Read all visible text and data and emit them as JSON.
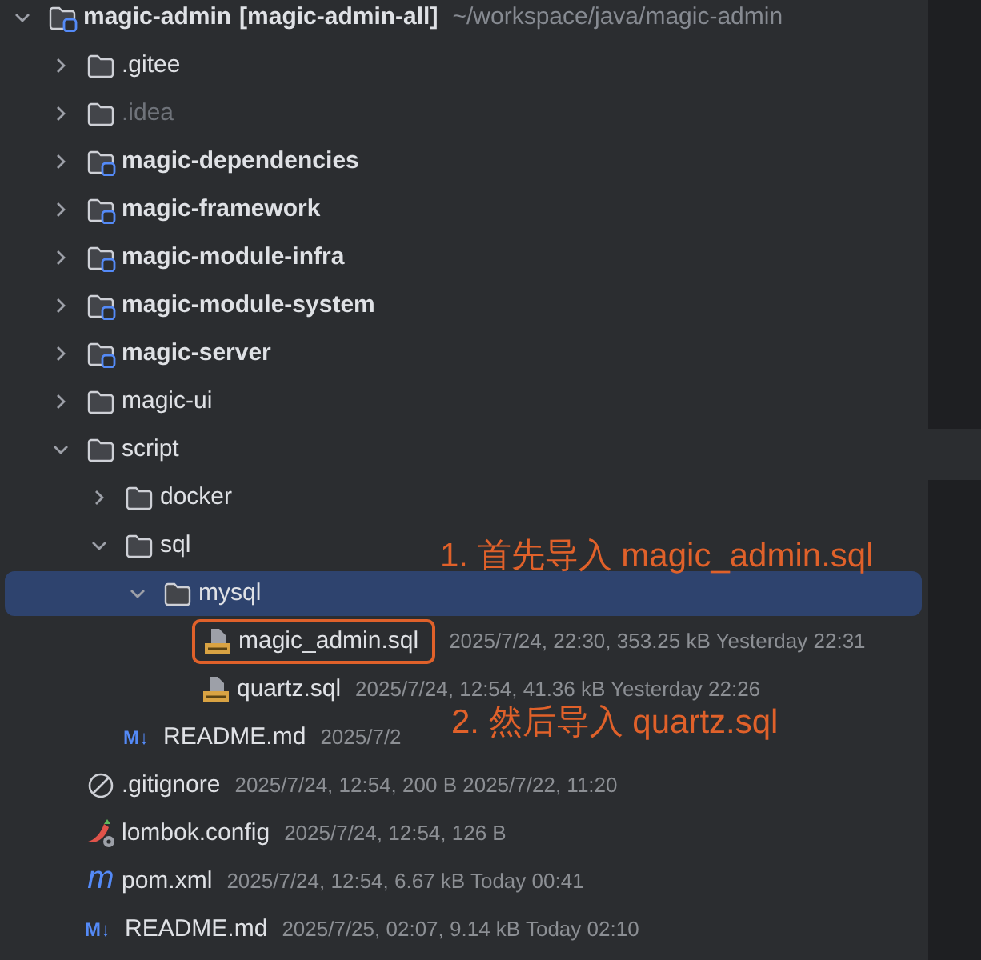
{
  "tree": [
    {
      "kind": "module",
      "name": "magic-admin",
      "module_label": "[magic-admin-all]",
      "path": "~/workspace/java/magic-admin",
      "expanded": true,
      "children": [
        {
          "kind": "folder",
          "name": ".gitee",
          "expanded": false
        },
        {
          "kind": "excluded_folder",
          "name": ".idea",
          "expanded": false
        },
        {
          "kind": "module",
          "name": "magic-dependencies",
          "expanded": false
        },
        {
          "kind": "module",
          "name": "magic-framework",
          "expanded": false
        },
        {
          "kind": "module",
          "name": "magic-module-infra",
          "expanded": false
        },
        {
          "kind": "module",
          "name": "magic-module-system",
          "expanded": false
        },
        {
          "kind": "module",
          "name": "magic-server",
          "expanded": false
        },
        {
          "kind": "folder",
          "name": "magic-ui",
          "expanded": false
        },
        {
          "kind": "folder",
          "name": "script",
          "expanded": true,
          "children": [
            {
              "kind": "folder",
              "name": "docker",
              "expanded": false
            },
            {
              "kind": "folder",
              "name": "sql",
              "expanded": true,
              "children": [
                {
                  "kind": "folder",
                  "name": "mysql",
                  "expanded": true,
                  "selected": true,
                  "note": "1. 首先导入 magic_admin.sql",
                  "children": [
                    {
                      "kind": "sql",
                      "name": "magic_admin.sql",
                      "meta": "2025/7/24, 22:30, 353.25 kB Yesterday 22:31",
                      "highlighted": true
                    },
                    {
                      "kind": "sql",
                      "name": "quartz.sql",
                      "meta": "2025/7/24, 12:54, 41.36 kB Yesterday 22:26",
                      "highlighted": false
                    }
                  ]
                }
              ]
            },
            {
              "kind": "md",
              "badge": "M↓",
              "name": "README.md",
              "meta": "2025/7/2",
              "note": "2. 然后导入 quartz.sql"
            }
          ]
        },
        {
          "kind": "gitignore",
          "name": ".gitignore",
          "meta": "2025/7/24, 12:54, 200 B 2025/7/22, 11:20"
        },
        {
          "kind": "lombok",
          "name": "lombok.config",
          "meta": "2025/7/24, 12:54, 126 B"
        },
        {
          "kind": "pom",
          "badge": "m",
          "name": "pom.xml",
          "meta": "2025/7/24, 12:54, 6.67 kB Today 00:41"
        },
        {
          "kind": "md",
          "badge": "M↓",
          "name": "README.md",
          "meta": "2025/7/25, 02:07, 9.14 kB Today 02:10"
        }
      ]
    }
  ]
}
